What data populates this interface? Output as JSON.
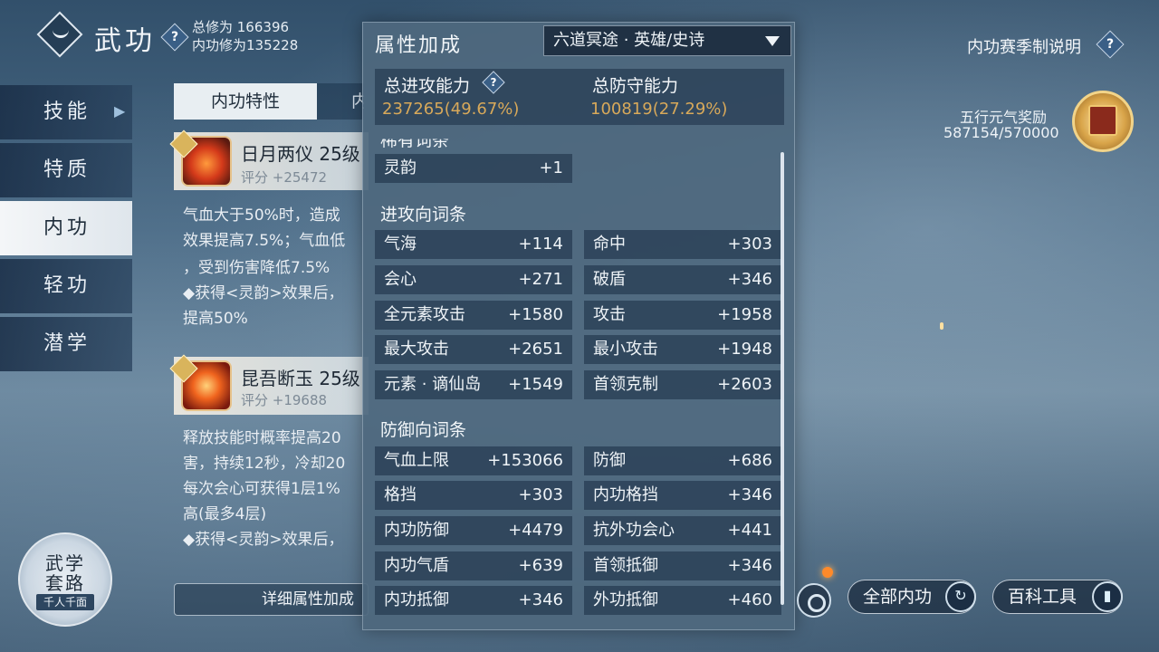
{
  "header": {
    "title": "武功",
    "total_cultivation": "总修为 166396",
    "inner_cultivation": "内功修为135228",
    "help_glyph": "?"
  },
  "nav": {
    "items": [
      "技能",
      "特质",
      "内功",
      "轻功",
      "潜学"
    ],
    "active_index": 2
  },
  "inner_panel": {
    "tabs": [
      "内功特性",
      "内"
    ],
    "cards": [
      {
        "name": "日月两仪 25级",
        "score": "评分 +25472",
        "desc": [
          "气血大于50%时，造成",
          "效果提高7.5%；气血低",
          "，受到伤害降低7.5%",
          "◆获得<灵韵>效果后，",
          "提高50%"
        ]
      },
      {
        "name": "昆吾断玉 25级",
        "score": "评分 +19688",
        "desc": [
          "释放技能时概率提高20",
          "害，持续12秒，冷却20",
          "每次会心可获得1层1%",
          "高(最多4层)",
          "◆获得<灵韵>效果后，"
        ]
      }
    ],
    "detail_button": "详细属性加成"
  },
  "wuxue": {
    "line1": "武学",
    "line2": "套路",
    "sub": "千人千面"
  },
  "popup": {
    "title": "属性加成",
    "dropdown_value": "六道冥途 · 英雄/史诗",
    "total_attack_label": "总进攻能力",
    "total_attack_value": "237265(49.67%)",
    "total_defense_label": "总防守能力",
    "total_defense_value": "100819(27.29%)",
    "rare_section": "稀有词条",
    "rare_rows": [
      {
        "k": "灵韵",
        "v": "+1"
      }
    ],
    "attack_section": "进攻向词条",
    "attack_rows": [
      {
        "k": "气海",
        "v": "+114"
      },
      {
        "k": "命中",
        "v": "+303"
      },
      {
        "k": "会心",
        "v": "+271"
      },
      {
        "k": "破盾",
        "v": "+346"
      },
      {
        "k": "全元素攻击",
        "v": "+1580"
      },
      {
        "k": "攻击",
        "v": "+1958"
      },
      {
        "k": "最大攻击",
        "v": "+2651"
      },
      {
        "k": "最小攻击",
        "v": "+1948"
      },
      {
        "k": "元素 · 谪仙岛",
        "v": "+1549"
      },
      {
        "k": "首领克制",
        "v": "+2603"
      }
    ],
    "defense_section": "防御向词条",
    "defense_rows": [
      {
        "k": "气血上限",
        "v": "+153066"
      },
      {
        "k": "防御",
        "v": "+686"
      },
      {
        "k": "格挡",
        "v": "+303"
      },
      {
        "k": "内功格挡",
        "v": "+346"
      },
      {
        "k": "内功防御",
        "v": "+4479"
      },
      {
        "k": "抗外功会心",
        "v": "+441"
      },
      {
        "k": "内功气盾",
        "v": "+639"
      },
      {
        "k": "首领抵御",
        "v": "+346"
      },
      {
        "k": "内功抵御",
        "v": "+346"
      },
      {
        "k": "外功抵御",
        "v": "+460"
      }
    ]
  },
  "top_right": {
    "season_link": "内功赛季制说明",
    "reward_label": "五行元气奖励",
    "reward_value": "587154/570000"
  },
  "bottom_right": {
    "all_inner_button": "全部内功",
    "wiki_button": "百科工具"
  },
  "colors": {
    "highlight": "#d8a95a",
    "panel": "#4e687e",
    "accent_blue": "#3a5f86"
  }
}
